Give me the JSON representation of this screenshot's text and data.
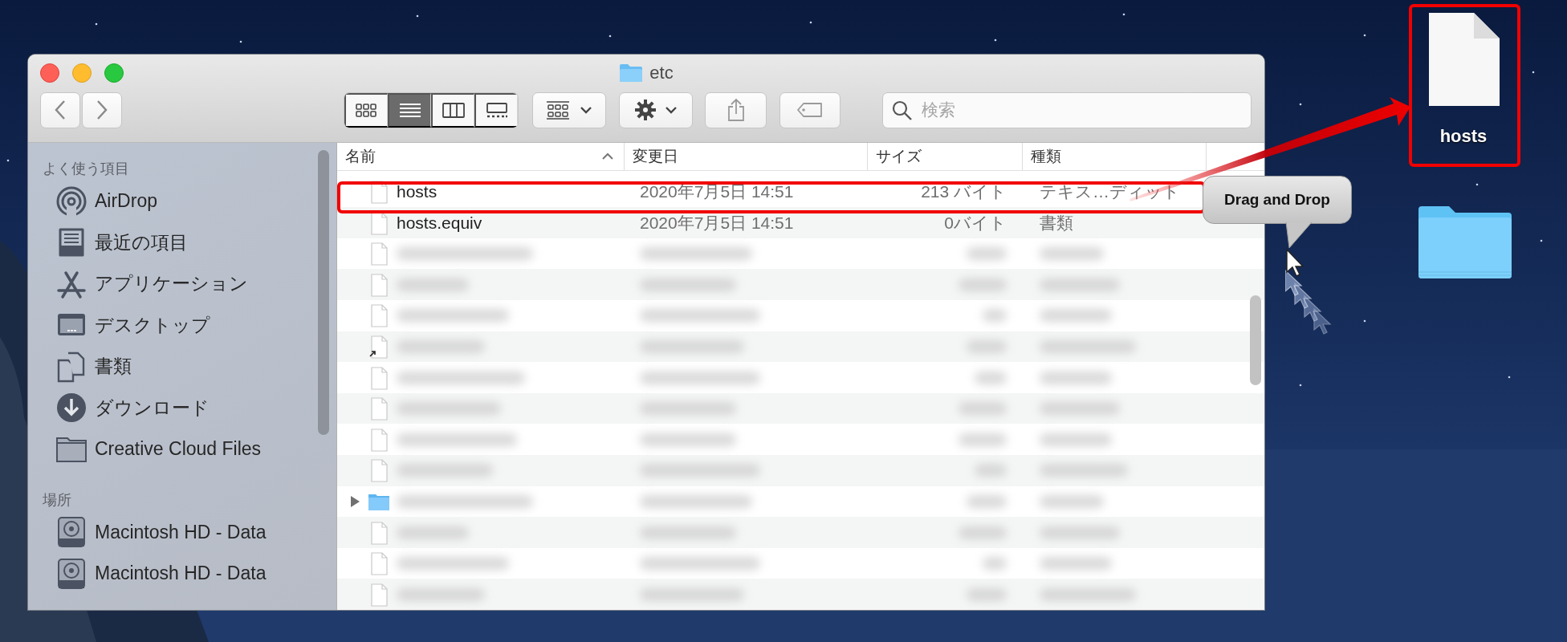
{
  "window": {
    "title": "etc"
  },
  "toolbar": {
    "view_modes": [
      {
        "kind": "icons",
        "selected": false
      },
      {
        "kind": "list",
        "selected": true
      },
      {
        "kind": "columns",
        "selected": false
      },
      {
        "kind": "gallery",
        "selected": false
      }
    ],
    "search": {
      "placeholder": "検索"
    }
  },
  "sidebar": {
    "sections": [
      {
        "heading": "よく使う項目",
        "items": [
          {
            "kind": "airdrop",
            "label": "AirDrop"
          },
          {
            "kind": "recents",
            "label": "最近の項目"
          },
          {
            "kind": "apps",
            "label": "アプリケーション"
          },
          {
            "kind": "desktop",
            "label": "デスクトップ"
          },
          {
            "kind": "documents",
            "label": "書類"
          },
          {
            "kind": "downloads",
            "label": "ダウンロード"
          },
          {
            "kind": "folder",
            "label": "Creative Cloud Files"
          }
        ]
      },
      {
        "heading": "場所",
        "items": [
          {
            "kind": "disk",
            "label": "Macintosh HD - Data"
          },
          {
            "kind": "disk",
            "label": "Macintosh HD - Data"
          }
        ]
      }
    ]
  },
  "file_list": {
    "columns": [
      {
        "label": "名前",
        "sorted": true
      },
      {
        "label": "変更日",
        "sorted": false
      },
      {
        "label": "サイズ",
        "sorted": false
      },
      {
        "label": "種類",
        "sorted": false
      }
    ],
    "rows": [
      {
        "kind": "file",
        "blurred": false,
        "annotated": true,
        "name": "hosts",
        "modified": "2020年7月5日 14:51",
        "size": "213 バイト",
        "type": "テキス…ディット"
      },
      {
        "kind": "file",
        "blurred": false,
        "annotated": false,
        "name": "hosts.equiv",
        "modified": "2020年7月5日 14:51",
        "size": "0バイト",
        "type": "書類"
      },
      {
        "kind": "file",
        "blurred": true,
        "annotated": false
      },
      {
        "kind": "file",
        "blurred": true,
        "annotated": false
      },
      {
        "kind": "file",
        "blurred": true,
        "annotated": false
      },
      {
        "kind": "alias",
        "blurred": true,
        "annotated": false
      },
      {
        "kind": "file",
        "blurred": true,
        "annotated": false
      },
      {
        "kind": "file",
        "blurred": true,
        "annotated": false
      },
      {
        "kind": "file",
        "blurred": true,
        "annotated": false
      },
      {
        "kind": "file",
        "blurred": true,
        "annotated": false
      },
      {
        "kind": "folder",
        "blurred": true,
        "annotated": false
      },
      {
        "kind": "file",
        "blurred": true,
        "annotated": false
      },
      {
        "kind": "file",
        "blurred": true,
        "annotated": false
      },
      {
        "kind": "file",
        "blurred": true,
        "annotated": false
      }
    ]
  },
  "desktop": {
    "icons": [
      {
        "kind": "file",
        "label": "hosts",
        "annotated": true
      },
      {
        "kind": "folder",
        "annotated": false
      }
    ]
  },
  "annotation": {
    "arrow": true,
    "callout": "Drag and Drop"
  }
}
